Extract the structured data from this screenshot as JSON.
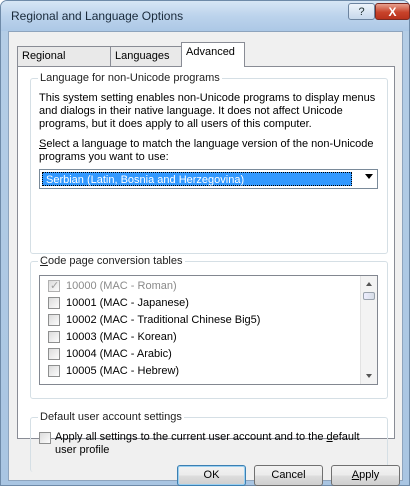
{
  "window": {
    "title": "Regional and Language Options",
    "help_label": "?",
    "close_label": "X"
  },
  "tabs": [
    {
      "label": "Regional Options",
      "active": false
    },
    {
      "label": "Languages",
      "active": false
    },
    {
      "label": "Advanced",
      "active": true
    }
  ],
  "nonunicode_group": {
    "title": "Language for non-Unicode programs",
    "description": "This system setting enables non-Unicode programs to display menus and dialogs in their native language. It does not affect Unicode programs, but it does apply to all users of this computer.",
    "select_prompt_accel": "S",
    "select_prompt_rest": "elect a language to match the language version of the non-Unicode programs you want to use:",
    "selected_language": "Serbian (Latin, Bosnia and Herzegovina)"
  },
  "codepage_group": {
    "title_accel": "C",
    "title_rest": "ode page conversion tables",
    "items": [
      {
        "label": "10000 (MAC - Roman)",
        "checked": true,
        "disabled": true
      },
      {
        "label": "10001 (MAC - Japanese)",
        "checked": false,
        "disabled": false
      },
      {
        "label": "10002 (MAC - Traditional Chinese Big5)",
        "checked": false,
        "disabled": false
      },
      {
        "label": "10003 (MAC - Korean)",
        "checked": false,
        "disabled": false
      },
      {
        "label": "10004 (MAC - Arabic)",
        "checked": false,
        "disabled": false
      },
      {
        "label": "10005 (MAC - Hebrew)",
        "checked": false,
        "disabled": false
      }
    ]
  },
  "default_group": {
    "title": "Default user account settings",
    "checkbox_line1_pre": "Apply all settings to the current user account and to the ",
    "checkbox_line1_accel": "d",
    "checkbox_line1_post": "efault",
    "checkbox_line2": "user profile",
    "checked": false
  },
  "buttons": {
    "ok": "OK",
    "cancel": "Cancel",
    "apply_accel": "A",
    "apply_rest": "pply"
  }
}
